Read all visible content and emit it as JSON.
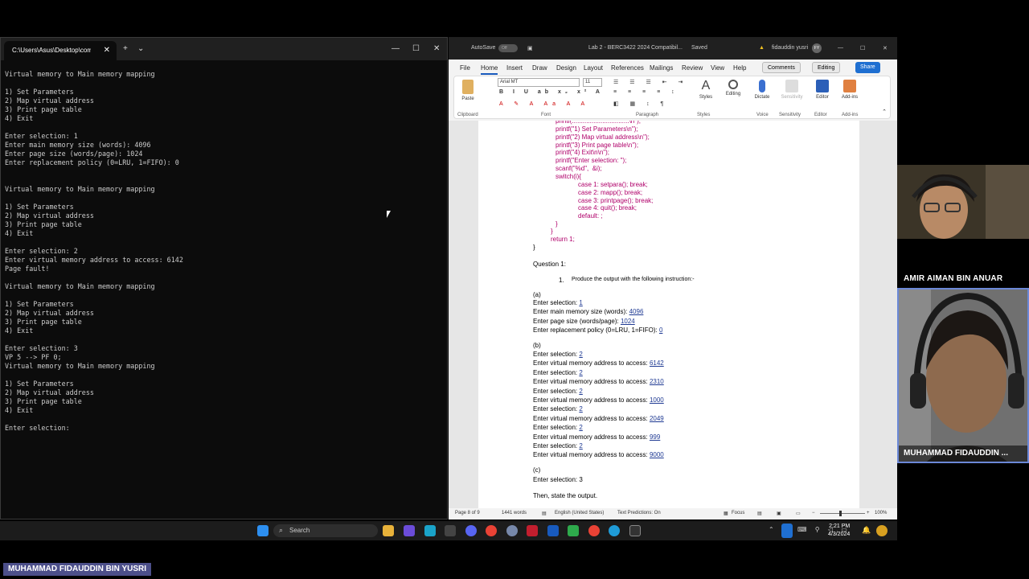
{
  "terminal": {
    "tab_title": "C:\\Users\\Asus\\Desktop\\comp",
    "lines": [
      "Virtual memory to Main memory mapping",
      "",
      "1) Set Parameters",
      "2) Map virtual address",
      "3) Print page table",
      "4) Exit",
      "",
      "Enter selection: 1",
      "Enter main memory size (words): 4096",
      "Enter page size (words/page): 1024",
      "Enter replacement policy (0=LRU, 1=FIFO): 0",
      "",
      "",
      "Virtual memory to Main memory mapping",
      "",
      "1) Set Parameters",
      "2) Map virtual address",
      "3) Print page table",
      "4) Exit",
      "",
      "Enter selection: 2",
      "Enter virtual memory address to access: 6142",
      "Page fault!",
      "",
      "Virtual memory to Main memory mapping",
      "",
      "1) Set Parameters",
      "2) Map virtual address",
      "3) Print page table",
      "4) Exit",
      "",
      "Enter selection: 3",
      "VP 5 --> PF 0;",
      "Virtual memory to Main memory mapping",
      "",
      "1) Set Parameters",
      "2) Map virtual address",
      "3) Print page table",
      "4) Exit",
      "",
      "Enter selection:"
    ]
  },
  "word": {
    "autosave_label": "AutoSave",
    "autosave_state": "Off",
    "doc_title": "Lab 2 - BERC3422 2024",
    "compat": "Compatibil...",
    "saved": "Saved",
    "user": "fidauddin yusri",
    "user_initials": "FY",
    "menu": [
      "File",
      "Home",
      "Insert",
      "Draw",
      "Design",
      "Layout",
      "References",
      "Mailings",
      "Review",
      "View",
      "Help"
    ],
    "comments_label": "Comments",
    "editing_label": "Editing",
    "share_label": "Share",
    "ribbon": {
      "paste": "Paste",
      "clipboard": "Clipboard",
      "font_name": "Arial MT",
      "font_size": "11",
      "font": "Font",
      "paragraph": "Paragraph",
      "styles": "Styles",
      "editing": "Editing",
      "dictate": "Dictate",
      "voice": "Voice",
      "sensitivity": "Sensitivity",
      "editor": "Editor",
      "addins": "Add-ins"
    },
    "code_lines": [
      "printf(\"1) Set Parameters\\n\");",
      "printf(\"2) Map virtual address\\n\");",
      "printf(\"3) Print page table\\n\");",
      "printf(\"4) Exit\\n\\n\");",
      "printf(\"Enter selection: \");",
      "scanf(\"%d\",  &i);",
      "switch(i){"
    ],
    "case_lines": [
      "case 1: setpara(); break;",
      "case 2: mapp(); break;",
      "case 3: printpage(); break;",
      "case 4: quit(); break;",
      "default: ;"
    ],
    "brace1": "}",
    "brace2": "}",
    "return_line": "return 1;",
    "brace3": "}",
    "question": "Question 1:",
    "instruction_num": "1.",
    "instruction": "Produce the output with the following instruction:-",
    "part_a": "(a)",
    "a_lines": [
      {
        "label": "Enter selection: ",
        "value": "1"
      },
      {
        "label": "Enter main memory size (words): ",
        "value": "4096"
      },
      {
        "label": "Enter page size (words/page): ",
        "value": "1024"
      },
      {
        "label": "Enter replacement policy (0=LRU, 1=FIFO): ",
        "value": "0"
      }
    ],
    "part_b": "(b)",
    "b_lines": [
      {
        "label": "Enter selection: ",
        "value": "2"
      },
      {
        "label": "Enter virtual memory address to access: ",
        "value": "6142"
      },
      {
        "label": "Enter selection: ",
        "value": "2"
      },
      {
        "label": "Enter virtual memory address to access: ",
        "value": "2310"
      },
      {
        "label": "Enter selection: ",
        "value": "2"
      },
      {
        "label": "Enter virtual memory address to access: ",
        "value": "1000"
      },
      {
        "label": "Enter selection: ",
        "value": "2"
      },
      {
        "label": "Enter virtual memory address to access: ",
        "value": "2049"
      },
      {
        "label": "Enter selection: ",
        "value": "2"
      },
      {
        "label": "Enter virtual memory address to access: ",
        "value": "999"
      },
      {
        "label": "Enter selection: ",
        "value": "2"
      },
      {
        "label": "Enter virtual memory address to access: ",
        "value": "9000"
      }
    ],
    "part_c": "(c)",
    "c_line": "Enter selection: 3",
    "final": "Then, state the output.",
    "status": {
      "page": "Page 8 of 9",
      "words": "1441 words",
      "language": "English (United States)",
      "predictions": "Text Predictions: On",
      "focus": "Focus",
      "zoom": "100%"
    }
  },
  "taskbar": {
    "search": "Search",
    "time": "2:21 PM",
    "date": "4/3/2024"
  },
  "participants": {
    "amir": "AMIR AIMAN BIN ANUAR",
    "fida_tile": "MUHAMMAD FIDAUDDIN ...",
    "fida_full": "MUHAMMAD FIDAUDDIN BIN YUSRI"
  }
}
